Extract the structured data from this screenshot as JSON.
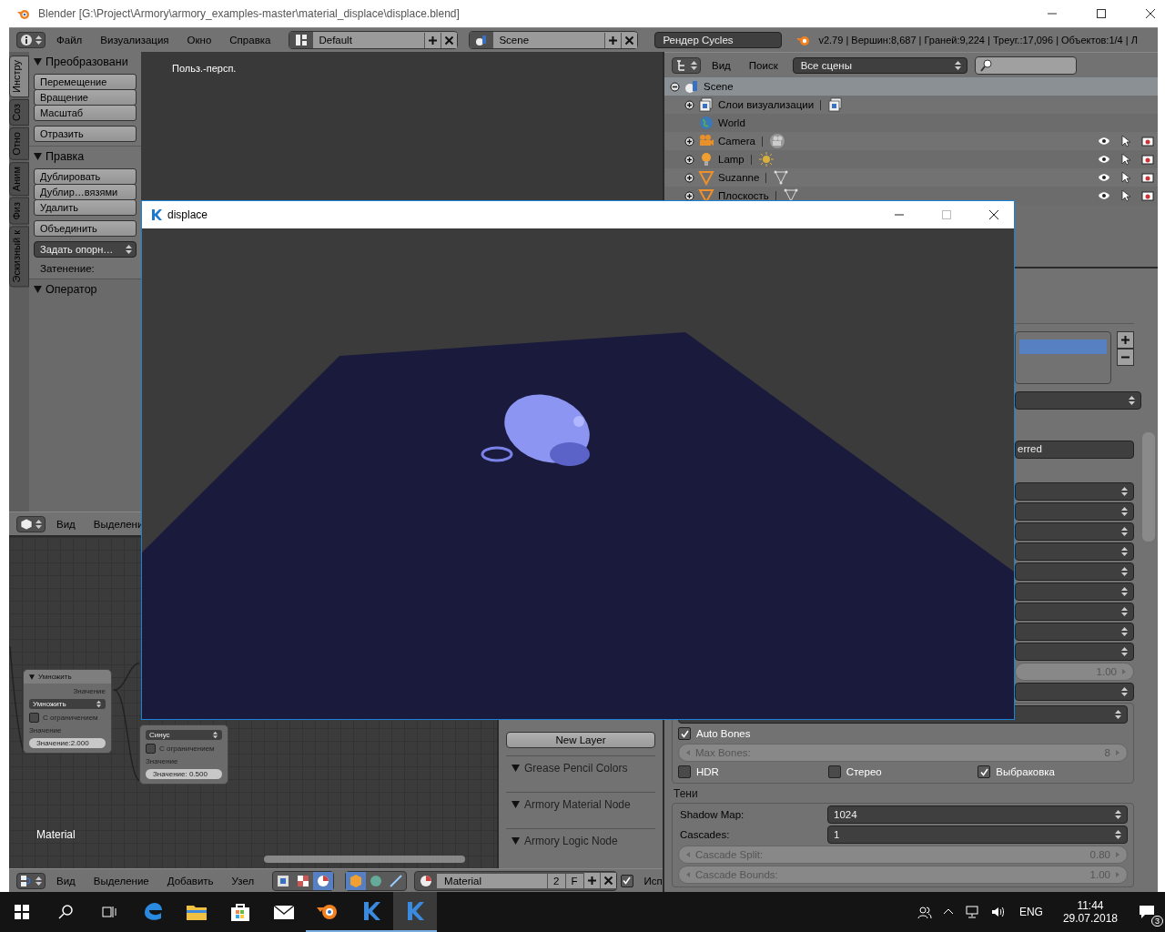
{
  "window": {
    "title": "Blender [G:\\Project\\Armory\\armory_examples-master\\material_displace\\displace.blend]"
  },
  "info_header": {
    "menus": [
      "Файл",
      "Визуализация",
      "Окно",
      "Справка"
    ],
    "layout": "Default",
    "scene": "Scene",
    "engine": "Рендер Cycles",
    "stats": "v2.79 | Вершин:8,687 | Граней:9,224 | Треуг.:17,096 | Объектов:1/4 | Л"
  },
  "tool_shelf": {
    "tabs": [
      {
        "label": "Инстру",
        "selected": true
      },
      {
        "label": "Соз",
        "selected": false
      },
      {
        "label": "Отно",
        "selected": false
      },
      {
        "label": "Аним",
        "selected": false
      },
      {
        "label": "Физ",
        "selected": false
      },
      {
        "label": "Эскизный к",
        "selected": false
      }
    ],
    "panels": [
      {
        "title": "Преобразовани",
        "items": [
          {
            "kind": "buttons",
            "labels": [
              "Перемещение",
              "Вращение",
              "Масштаб"
            ]
          },
          {
            "kind": "buttons",
            "labels": [
              "Отразить"
            ]
          }
        ]
      },
      {
        "title": "Правка",
        "items": [
          {
            "kind": "buttons",
            "labels": [
              "Дублировать",
              "Дублир…вязями",
              "Удалить"
            ]
          },
          {
            "kind": "buttons",
            "labels": [
              "Объединить"
            ]
          },
          {
            "kind": "dropdown",
            "label": "Задать опорн…"
          },
          {
            "kind": "label",
            "label": "Затенение:"
          }
        ]
      },
      {
        "title": "Оператор"
      }
    ]
  },
  "viewport": {
    "label": "Польз.-персп."
  },
  "view3d_header": {
    "menus": [
      "Вид",
      "Выделени"
    ]
  },
  "node_editor": {
    "nodes": [
      {
        "title": "Умножить",
        "output": "Значение",
        "operation": "Умножить",
        "clamp_label": "С ограничением",
        "clamp": false,
        "input": "Значение",
        "value": "Значение:2.000"
      },
      {
        "operation": "Синус",
        "clamp_label": "С ограничением",
        "clamp": false,
        "input": "Значение",
        "value": "Значение: 0.500"
      }
    ],
    "material_label": "Material"
  },
  "node_panel": {
    "button": "New Layer",
    "panels": [
      "Grease Pencil Colors",
      "Armory Material Node",
      "Armory Logic Node"
    ]
  },
  "node_header": {
    "menus": [
      "Вид",
      "Выделение",
      "Добавить",
      "Узел"
    ],
    "material": "Material",
    "users": "2",
    "fake_user": "F",
    "use_nodes_label": "Исп",
    "use_nodes": true
  },
  "outliner": {
    "menus": [
      "Вид",
      "Поиск"
    ],
    "filter": "Все сцены",
    "rows": [
      {
        "kind": "scene",
        "label": "Scene",
        "selected": true,
        "expanded": true,
        "children": [
          {
            "kind": "render_layers",
            "label": "Слои визуализации",
            "selected": false,
            "expanded": false,
            "restrict_icons": false
          },
          {
            "kind": "world",
            "label": "World",
            "selected": false,
            "restrict_icons": false
          },
          {
            "kind": "camera",
            "label": "Camera",
            "selected": false,
            "expanded": false,
            "restrict_icons": true
          },
          {
            "kind": "lamp",
            "label": "Lamp",
            "selected": false,
            "expanded": false,
            "restrict_icons": true
          },
          {
            "kind": "mesh",
            "label": "Suzanne",
            "selected": false,
            "expanded": false,
            "restrict_icons": true
          },
          {
            "kind": "mesh",
            "label": "Плоскость",
            "selected": false,
            "expanded": false,
            "restrict_icons": true
          }
        ]
      }
    ]
  },
  "properties": {
    "field_text": "erred",
    "number_value": "1.00",
    "auto_bones": {
      "label": "Auto Bones",
      "checked": true
    },
    "max_bones": {
      "label": "Max Bones:",
      "value": "8"
    },
    "toggles": [
      {
        "label": "HDR",
        "checked": false
      },
      {
        "label": "Стерео",
        "checked": false
      },
      {
        "label": "Выбраковка",
        "checked": true
      }
    ],
    "shadows": {
      "title": "Тени",
      "fields": [
        {
          "kind": "dropdown",
          "label": "Shadow Map:",
          "value": "1024"
        },
        {
          "kind": "dropdown",
          "label": "Cascades:",
          "value": "1"
        },
        {
          "kind": "number",
          "label": "Cascade Split:",
          "value": "0.80"
        },
        {
          "kind": "number",
          "label": "Cascade Bounds:",
          "value": "1.00"
        }
      ]
    }
  },
  "player_window": {
    "title": "displace"
  },
  "taskbar": {
    "apps": [
      {
        "kind": "edge",
        "running": false,
        "selected": false
      },
      {
        "kind": "folder",
        "running": false,
        "selected": false
      },
      {
        "kind": "store",
        "running": false,
        "selected": false
      },
      {
        "kind": "mail",
        "running": false,
        "selected": false
      },
      {
        "kind": "blender",
        "running": true,
        "selected": false
      },
      {
        "kind": "kha",
        "running": true,
        "selected": false
      },
      {
        "kind": "kha",
        "running": true,
        "selected": true
      }
    ],
    "language": "ENG",
    "time": "11:44",
    "date": "29.07.2018",
    "notifications": "3"
  }
}
